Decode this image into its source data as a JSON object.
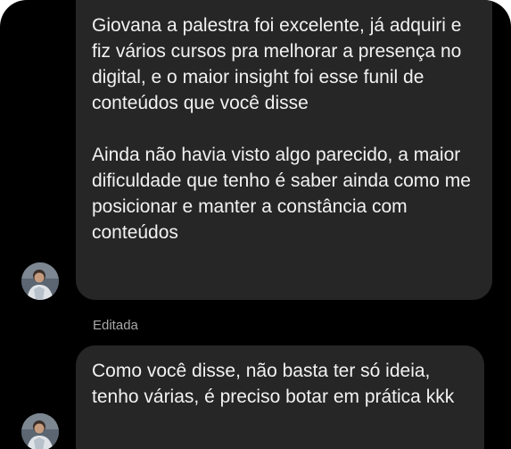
{
  "conversation": {
    "messages": [
      {
        "paragraphs": [
          "Giovana a palestra foi excelente, já adquiri e fiz vários cursos pra melhorar a presença no digital, e o maior insight foi esse funil de conteúdos que você disse",
          "Ainda não havia visto algo parecido, a maior dificuldade que tenho é saber ainda como me posicionar e manter a constância com conteúdos"
        ],
        "avatar": "user-avatar"
      },
      {
        "edited_label": "Editada",
        "paragraphs": [
          "Como você disse, não basta ter só ideia, tenho várias, é preciso botar em prática kkk"
        ],
        "avatar": "user-avatar"
      }
    ]
  },
  "colors": {
    "background": "#000000",
    "bubble": "#262626",
    "text": "#f2f2f2",
    "muted": "#a8a8a8"
  }
}
